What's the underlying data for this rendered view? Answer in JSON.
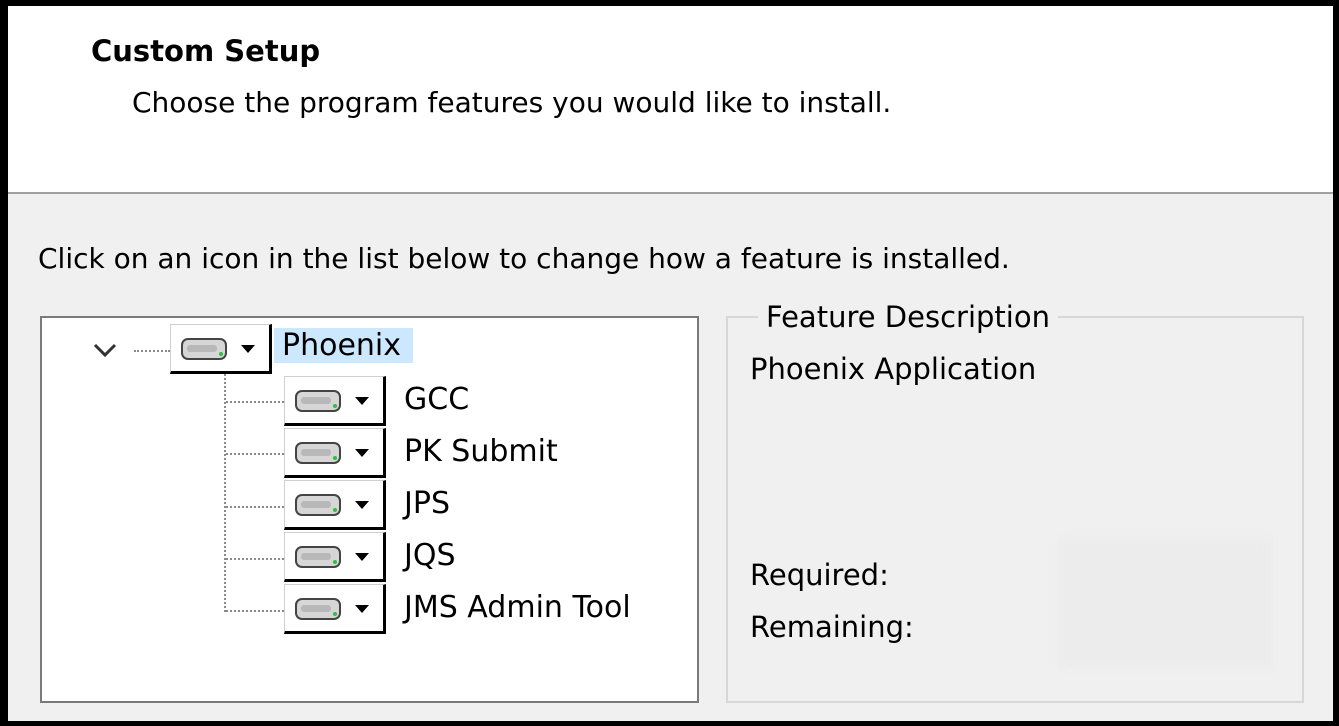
{
  "header": {
    "title": "Custom Setup",
    "subtitle": "Choose the program features you would like to install."
  },
  "instruction": "Click on an icon in the list below to change how a feature is installed.",
  "tree": {
    "root": {
      "label": "Phoenix",
      "icon": "hard-drive-icon",
      "selected": true,
      "expanded": true
    },
    "children": [
      {
        "label": "GCC",
        "icon": "hard-drive-icon"
      },
      {
        "label": "PK Submit",
        "icon": "hard-drive-icon"
      },
      {
        "label": "JPS",
        "icon": "hard-drive-icon"
      },
      {
        "label": "JQS",
        "icon": "hard-drive-icon"
      },
      {
        "label": "JMS Admin Tool",
        "icon": "hard-drive-icon"
      }
    ]
  },
  "feature_description": {
    "legend": "Feature Description",
    "text": "Phoenix Application",
    "required_label": "Required:",
    "remaining_label": "Remaining:",
    "required_value": "",
    "remaining_value": ""
  },
  "colors": {
    "selection": "#cce8ff",
    "dialog_bg": "#f0f0f0",
    "header_bg": "#ffffff"
  }
}
